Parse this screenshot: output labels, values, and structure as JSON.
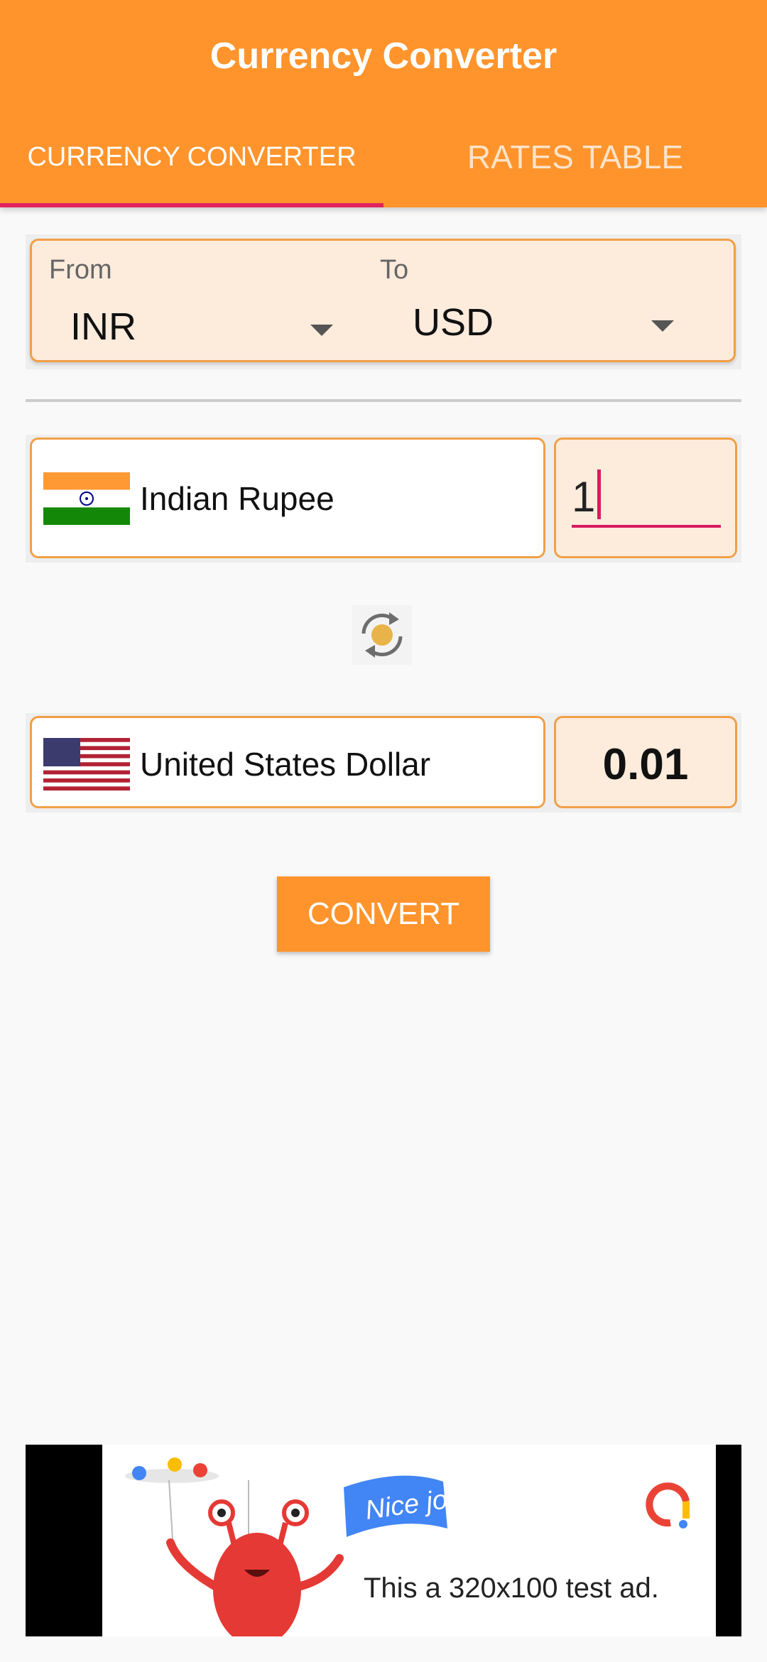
{
  "app": {
    "title": "Currency Converter"
  },
  "tabs": [
    {
      "label": "CURRENCY CONVERTER",
      "active": true
    },
    {
      "label": "RATES TABLE",
      "active": false
    }
  ],
  "pair": {
    "from_label": "From",
    "to_label": "To",
    "from_code": "INR",
    "to_code": "USD"
  },
  "source": {
    "name": "Indian Rupee",
    "amount": "1"
  },
  "target": {
    "name": "United States Dollar",
    "result": "0.01"
  },
  "actions": {
    "convert_label": "CONVERT"
  },
  "ad": {
    "badge": "Nice job!",
    "text": "This a 320x100 test ad."
  },
  "colors": {
    "primary": "#ff942c",
    "accent": "#e0245e",
    "field_bg": "#fdebdc",
    "field_border": "#f0a048"
  },
  "icons": {
    "swap": "refresh-swap-icon",
    "dropdown": "chevron-down-icon"
  }
}
